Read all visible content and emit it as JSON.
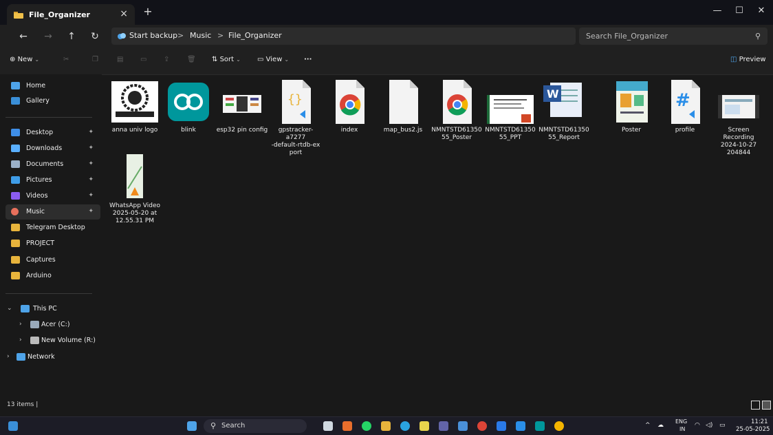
{
  "tab": {
    "title": "File_Organizer",
    "close": "×",
    "new": "+"
  },
  "window_controls": {
    "minimize": "—",
    "maximize": "☐",
    "close": "✕"
  },
  "nav": {
    "back": "←",
    "forward": "→",
    "up": "↑",
    "refresh": "↻"
  },
  "breadcrumb": {
    "root": "Start backup",
    "sep": ">",
    "items": [
      "Music",
      "File_Organizer"
    ]
  },
  "search": {
    "placeholder": "Search File_Organizer"
  },
  "toolbar": {
    "new": "New",
    "sort": "Sort",
    "view": "View",
    "more": "···",
    "preview": "Preview"
  },
  "sidebar": {
    "quick": [
      {
        "label": "Home",
        "color": "#4ea3e8"
      },
      {
        "label": "Gallery",
        "color": "#3a8fd8"
      }
    ],
    "pinned": [
      {
        "label": "Desktop",
        "color": "#3f8fe8",
        "pin": "📌"
      },
      {
        "label": "Downloads",
        "color": "#5ab0ff",
        "pin": "📌"
      },
      {
        "label": "Documents",
        "color": "#9ab0c8",
        "pin": "📌"
      },
      {
        "label": "Pictures",
        "color": "#3f9de8",
        "pin": "📌"
      },
      {
        "label": "Videos",
        "color": "#8b5cf0",
        "pin": "📌"
      },
      {
        "label": "Music",
        "color": "#e8705c",
        "pin": "📌"
      }
    ],
    "folders": [
      {
        "label": "Telegram Desktop",
        "color": "#e8b43c"
      },
      {
        "label": "PROJECT",
        "color": "#e8b43c"
      },
      {
        "label": "Captures",
        "color": "#e8b43c"
      },
      {
        "label": "Arduino",
        "color": "#e8b43c"
      }
    ],
    "tree": [
      {
        "label": "This PC",
        "color": "#4ea3e8",
        "exp": "⌄"
      },
      {
        "label": "Acer (C:)",
        "color": "#9ab",
        "exp": "›"
      },
      {
        "label": "New Volume (R:)",
        "color": "#bbb",
        "exp": "›"
      },
      {
        "label": "Network",
        "color": "#4ea3e8",
        "exp": "›"
      }
    ]
  },
  "files": [
    {
      "name": "anna univ logo",
      "kind": "logo"
    },
    {
      "name": "blink",
      "kind": "arduino"
    },
    {
      "name": "esp32 pin config",
      "kind": "image"
    },
    {
      "name": "gpstracker-a7277\n-default-rtdb-ex\nport",
      "kind": "json"
    },
    {
      "name": "index",
      "kind": "chrome"
    },
    {
      "name": "map_bus2.js",
      "kind": "blank"
    },
    {
      "name": "NMNTSTD61350\n55_Poster",
      "kind": "chrome-doc"
    },
    {
      "name": "NMNTSTD61350\n55_PPT",
      "kind": "ppt"
    },
    {
      "name": "NMNTSTD61350\n55_Report",
      "kind": "word"
    },
    {
      "name": "Poster",
      "kind": "poster"
    },
    {
      "name": "profile",
      "kind": "css"
    },
    {
      "name": "Screen Recording\n2024-10-27\n204844",
      "kind": "video"
    },
    {
      "name": "WhatsApp Video\n2025-05-20 at\n12.55.31 PM",
      "kind": "phone"
    }
  ],
  "status": {
    "count": "13 items  |"
  },
  "taskbar": {
    "search": "Search",
    "lang": "ENG",
    "region": "IN",
    "time": "11:21",
    "date": "25-05-2025"
  }
}
